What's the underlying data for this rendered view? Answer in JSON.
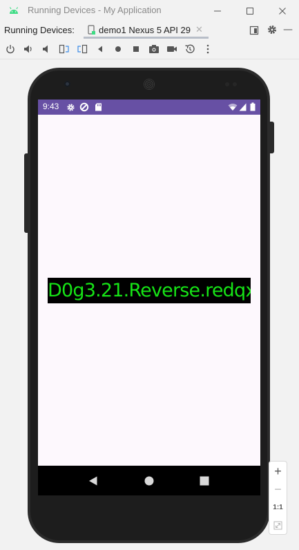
{
  "window": {
    "title": "Running Devices - My Application",
    "minimize_icon": "minimize-icon",
    "maximize_icon": "maximize-icon",
    "close_icon": "close-icon"
  },
  "tabs": {
    "label": "Running Devices:",
    "items": [
      {
        "label": "demo1 Nexus 5 API 29",
        "icon": "device-icon",
        "selected": true
      }
    ]
  },
  "toolbar": {
    "items": [
      "power-icon",
      "volume-up-icon",
      "volume-down-icon",
      "rotate-left-icon",
      "rotate-right-icon",
      "back-icon",
      "home-icon",
      "overview-icon",
      "screenshot-icon",
      "screen-record-icon",
      "snapshot-icon",
      "more-icon"
    ]
  },
  "device": {
    "status_time": "9:43",
    "status_bar_color": "#6750a4",
    "main_text": "D0g3.21.Reverse.redqx",
    "text_color": "#16e316",
    "text_bg": "#000000",
    "screen_bg": "#fdf8fd"
  },
  "zoom": {
    "zoom_in": "+",
    "zoom_out": "−",
    "actual_size": "1:1"
  },
  "colors": {
    "accent": "#3c8ce7",
    "android_green": "#3ddc84"
  }
}
